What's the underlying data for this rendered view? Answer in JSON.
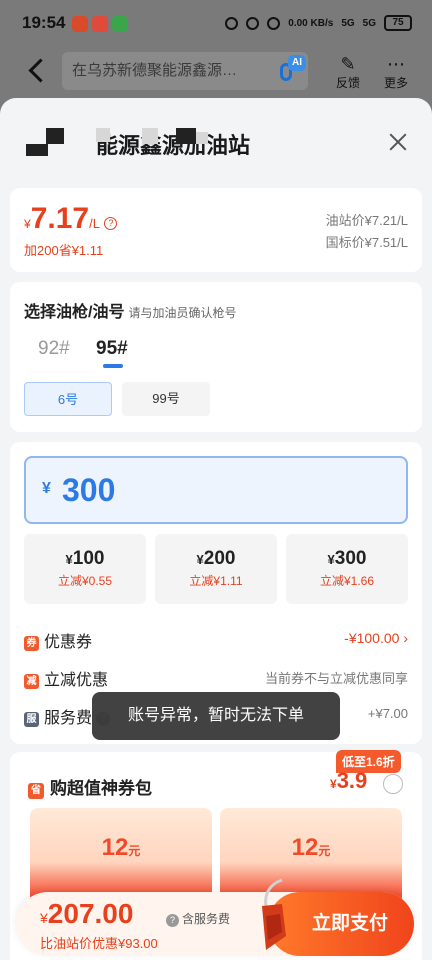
{
  "status_bar": {
    "time": "19:54",
    "network_speed": "0.00 KB/s",
    "signal1": "5G",
    "signal2": "5G",
    "battery": "75"
  },
  "header": {
    "search_text": "在乌苏新德聚能源鑫源…",
    "ai_badge": "AI",
    "feedback_label": "反馈",
    "more_label": "更多"
  },
  "station": {
    "title_visible": "能源鑫源加油站"
  },
  "price": {
    "currency": "¥",
    "value": "7.17",
    "unit": "/L",
    "saving_hint": "加200省¥1.11",
    "station_price": "油站价¥7.21/L",
    "national_price": "国标价¥7.51/L"
  },
  "gun_section": {
    "title": "选择油枪/油号",
    "hint": "请与加油员确认枪号",
    "oil_types": [
      "92#",
      "95#"
    ],
    "selected_oil": "95#",
    "guns": [
      "6号",
      "99号"
    ],
    "selected_gun": "6号"
  },
  "amount": {
    "currency": "¥",
    "value": "300",
    "presets": [
      {
        "price": "100",
        "discount": "立减¥0.55"
      },
      {
        "price": "200",
        "discount": "立减¥1.11"
      },
      {
        "price": "300",
        "discount": "立减¥1.66"
      }
    ],
    "coupon_label": "优惠券",
    "coupon_value": "-¥100.00",
    "instant_label": "立减优惠",
    "instant_value": "当前券不与立减优惠同享",
    "service_label": "服务费",
    "service_value": "+¥7.00",
    "tag_coupon": "券",
    "tag_instant": "减",
    "tag_service": "服"
  },
  "package": {
    "tag": "省",
    "title": "购超值神券包",
    "badge": "低至1.6折",
    "currency": "¥",
    "price": "3.9",
    "vouchers": [
      {
        "value": "12",
        "unit": "元"
      },
      {
        "value": "12",
        "unit": "元"
      }
    ]
  },
  "toast": "账号异常，暂时无法下单",
  "paybar": {
    "currency": "¥",
    "total": "207.00",
    "note": "含服务费",
    "saving": "比油站价优惠¥93.00",
    "pay_label": "立即支付"
  },
  "colors": {
    "accent_red": "#e8401c",
    "accent_blue": "#2c7be5",
    "pay_gradient_start": "#ff7a2a",
    "pay_gradient_end": "#f0441c"
  }
}
